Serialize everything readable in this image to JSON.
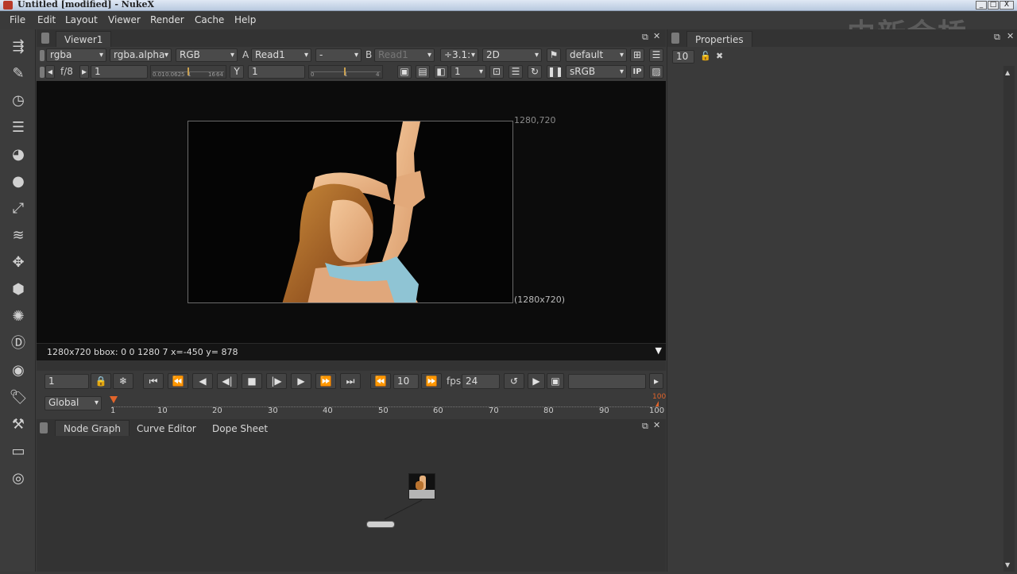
{
  "window": {
    "title": "Untitled [modified] - NukeX",
    "min": "_",
    "max": "□",
    "close": "X"
  },
  "menu": [
    "File",
    "Edit",
    "Layout",
    "Viewer",
    "Render",
    "Cache",
    "Help"
  ],
  "watermark": "中新金桥",
  "viewer": {
    "tab": "Viewer1",
    "channels": "rgba",
    "alpha_channel": "rgba.alpha",
    "display_channel": "RGB",
    "a_label": "A",
    "a_input": "Read1",
    "compare_mode": "-",
    "b_label": "B",
    "b_input": "Read1",
    "zoom": "÷3.1:",
    "view_mode": "2D",
    "lut_default": "default",
    "fstop": "f/8",
    "gain_value": "1",
    "gain_ticks": [
      "0.01",
      "0.0625",
      "1",
      "16",
      "64"
    ],
    "gamma_label": "Y",
    "gamma_value": "1",
    "gamma_ticks": [
      "0",
      "1",
      "4"
    ],
    "proxy_value": "1",
    "colorspace": "sRGB",
    "ip_label": "IP",
    "format_top": "1280,720",
    "format_bottom": "(1280x720)",
    "status": "1280x720 bbox: 0 0 1280 7  x=-450 y= 878"
  },
  "playback": {
    "frame": "1",
    "increment": "10",
    "fps_label": "fps",
    "fps": "24"
  },
  "timeline": {
    "scope": "Global",
    "start": "1",
    "end": "100",
    "ticks": [
      "10",
      "20",
      "30",
      "40",
      "50",
      "60",
      "70",
      "80",
      "90",
      "100"
    ]
  },
  "bottom_tabs": [
    "Node Graph",
    "Curve Editor",
    "Dope Sheet"
  ],
  "properties": {
    "tab": "Properties",
    "max_panels": "10"
  },
  "colors": {
    "accent_orange": "#e2642a",
    "bg": "#3a3a3a",
    "viewport": "#0c0c0c"
  }
}
